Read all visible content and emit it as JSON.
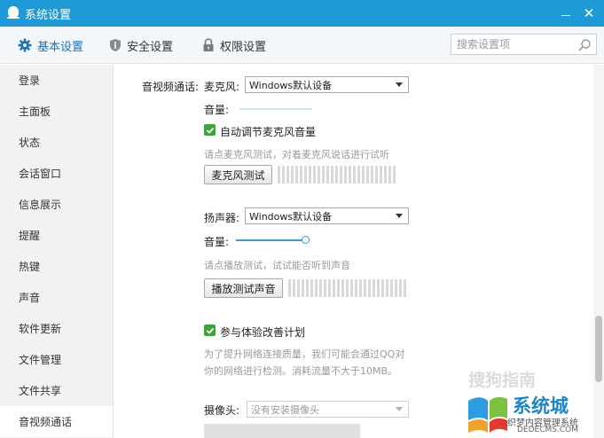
{
  "window": {
    "title": "系统设置"
  },
  "tabs": [
    {
      "label": "基本设置",
      "icon": "gear-icon",
      "active": true
    },
    {
      "label": "安全设置",
      "icon": "shield-icon"
    },
    {
      "label": "权限设置",
      "icon": "lock-icon"
    }
  ],
  "search": {
    "placeholder": "搜索设置项"
  },
  "sidebar": {
    "items": [
      {
        "label": "登录"
      },
      {
        "label": "主面板"
      },
      {
        "label": "状态"
      },
      {
        "label": "会话窗口"
      },
      {
        "label": "信息展示"
      },
      {
        "label": "提醒"
      },
      {
        "label": "热键"
      },
      {
        "label": "声音"
      },
      {
        "label": "软件更新"
      },
      {
        "label": "文件管理"
      },
      {
        "label": "文件共享"
      },
      {
        "label": "音视频通话",
        "active": true
      }
    ]
  },
  "av": {
    "section_label": "音视频通话:",
    "mic": {
      "label": "麦克风:",
      "device": "Windows默认设备",
      "volume_label": "音量:",
      "auto_adjust_label": "自动调节麦克风音量",
      "auto_adjust_checked": true,
      "hint": "请点麦克风测试，对着麦克风说话进行试听",
      "test_button": "麦克风测试"
    },
    "speaker": {
      "label": "扬声器:",
      "device": "Windows默认设备",
      "volume_label": "音量:",
      "volume_level": 0.95,
      "hint": "请点播放测试，试试能否听到声音",
      "test_button": "播放测试声音"
    },
    "experience": {
      "label": "参与体验改善计划",
      "checked": true,
      "desc_line1": "为了提升网络连接质量，我们可能会通过QQ对",
      "desc_line2": "你的网络进行检测。消耗流量不大于10MB。"
    },
    "camera": {
      "label": "摄像头:",
      "device": "没有安装摄像头"
    }
  },
  "watermarks": {
    "sogou": "搜狗指南",
    "brand": "系统城",
    "site_cn": "织梦内容管理系统",
    "site_en": "DEDECMS.COM"
  },
  "colors": {
    "titlebar": "#1e9bd6",
    "accent": "#1f72b8",
    "check": "#3da33a"
  }
}
